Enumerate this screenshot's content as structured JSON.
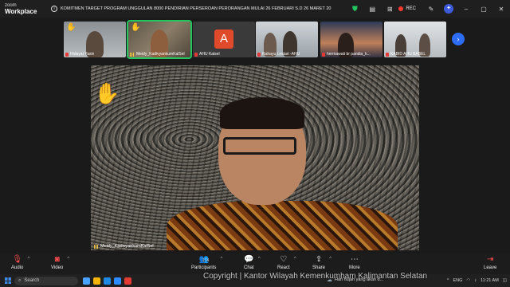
{
  "app": {
    "brand_top": "zoom",
    "brand_bottom": "Workplace"
  },
  "titlebar": {
    "banner": "KOMITMEN TARGET PROGRAM UNGGULAN 8000 PENDIRIAN PERSEROAN PERORANGAN MULAI 26 FEBRUARI S.D 26 MARET 20",
    "rec_label": "REC",
    "colors": {
      "shield": "#22c55e",
      "rec": "#ff3b30"
    }
  },
  "thumbnails": [
    {
      "name": "Hidayat Yasin",
      "hand": true
    },
    {
      "name": "Meidy_KadivyankumKalSel",
      "hand": true,
      "active": true
    },
    {
      "name": "AHU Kalsel",
      "avatar_letter": "A"
    },
    {
      "name": "Rahayu Lestari -AHU"
    },
    {
      "name": "hermawati br pandia_k..."
    },
    {
      "name": "KABID AHU BABEL"
    }
  ],
  "main_video": {
    "name": "Meidy_KadivyankumKalSel",
    "hand": true
  },
  "toolbar": {
    "audio": "Audio",
    "video": "Video",
    "participants": "Participants",
    "participants_count": "174",
    "chat": "Chat",
    "react": "React",
    "share": "Share",
    "more": "More",
    "leave": "Leave"
  },
  "taskbar": {
    "search": "Search",
    "watermark": "Copyright | Kantor Wilayah Kemenkumham Kalimantan Selatan",
    "weather": "Hari hujan yang akan d...",
    "lang": "ENG",
    "time": "11:21 AM"
  }
}
